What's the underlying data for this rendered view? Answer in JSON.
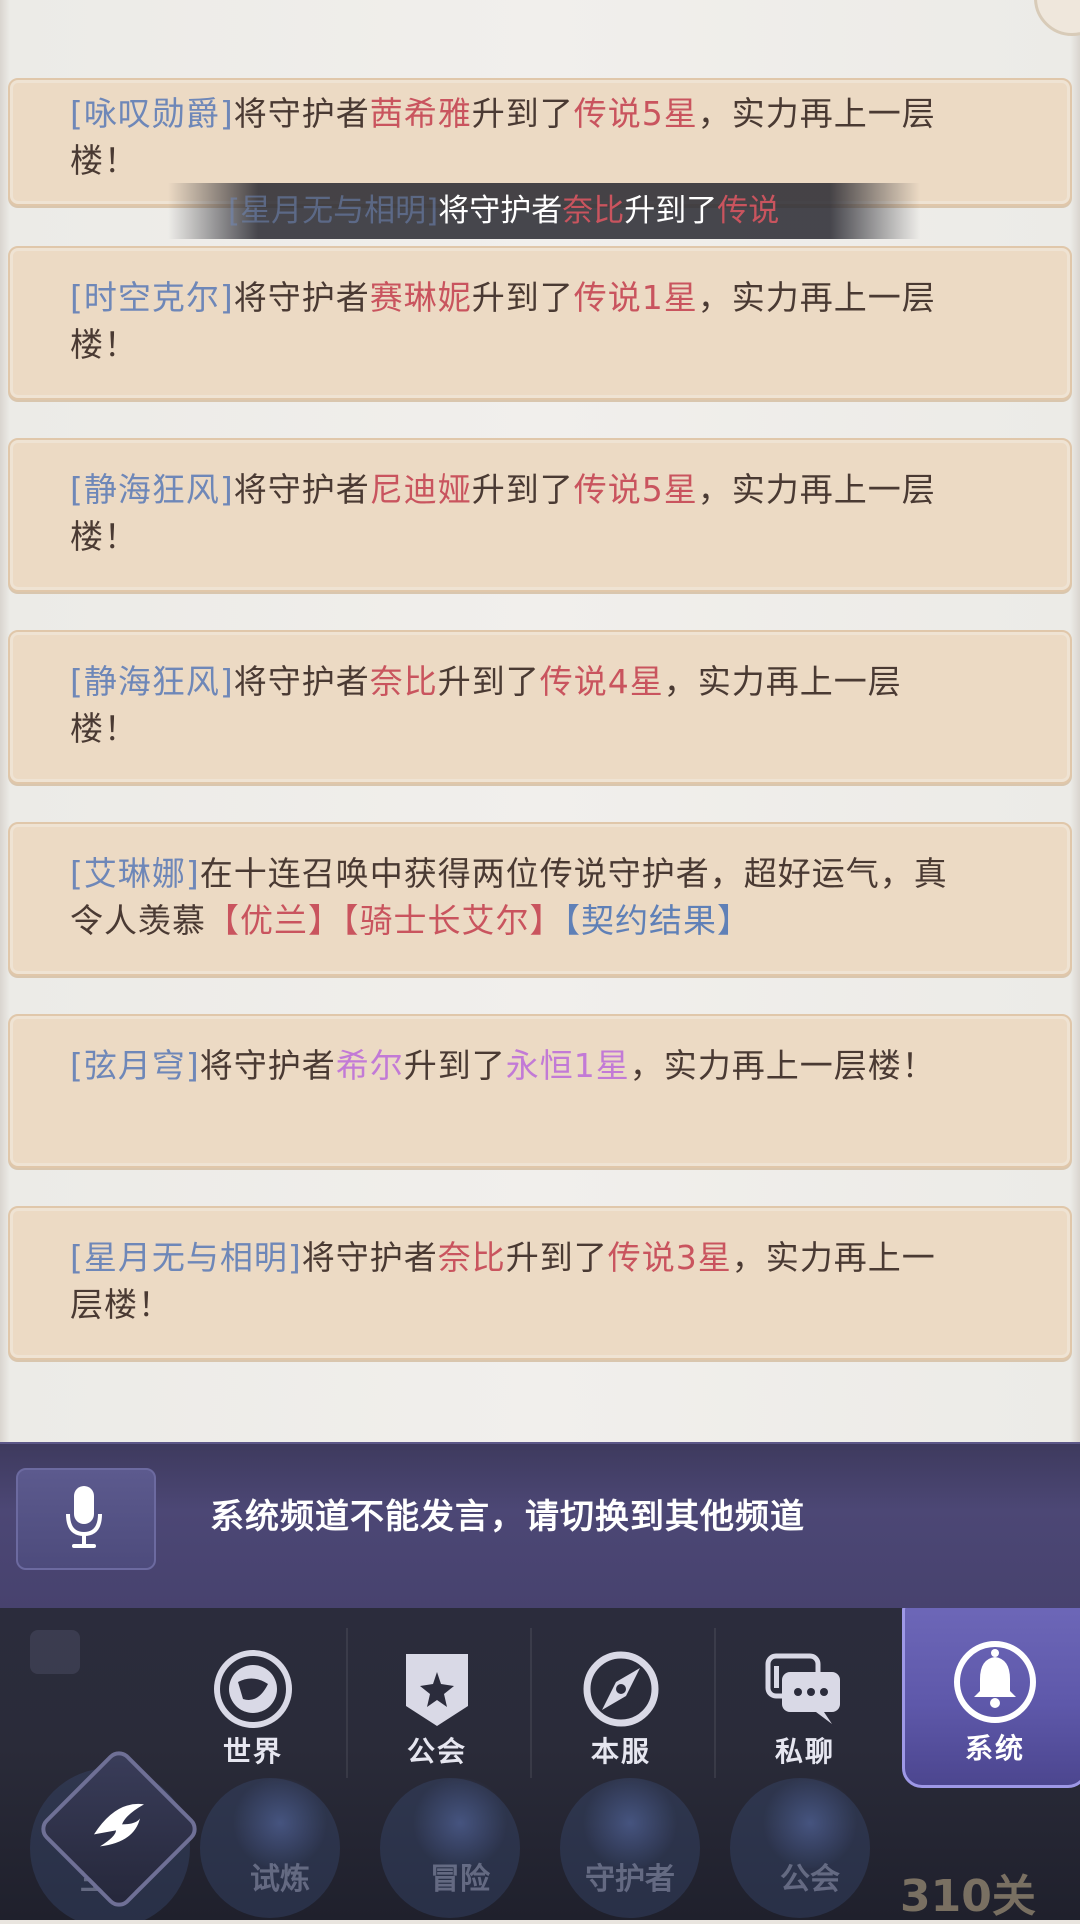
{
  "messages": [
    {
      "name": "[咏叹勋爵]",
      "pre": "将守护者",
      "hero": "茜希雅",
      "mid": "升到了",
      "rank": "传说5星",
      "post": "，实力再上一层楼！"
    },
    {
      "name": "[时空克尔]",
      "pre": "将守护者",
      "hero": "赛琳妮",
      "mid": "升到了",
      "rank": "传说1星",
      "post": "，实力再上一层楼！"
    },
    {
      "name": "[静海狂风]",
      "pre": "将守护者",
      "hero": "尼迪娅",
      "mid": "升到了",
      "rank": "传说5星",
      "post": "，实力再上一层楼！"
    },
    {
      "name": "[静海狂风]",
      "pre": "将守护者",
      "hero": "奈比",
      "mid": "升到了",
      "rank": "传说4星",
      "post": "，实力再上一层楼！"
    },
    {
      "name": "[艾琳娜]",
      "text": "在十连召唤中获得两位传说守护者，超好运气，真令人羡慕",
      "tag1": "【优兰】",
      "tag2": "【骑士长艾尔】",
      "tag3": "【契约结果】"
    },
    {
      "name": "[弦月穹]",
      "pre": "将守护者",
      "hero": "希尔",
      "mid": "升到了",
      "rank": "永恒1星",
      "post": "，实力再上一层楼！"
    },
    {
      "name": "[星月无与相明]",
      "pre": "将守护者",
      "hero": "奈比",
      "mid": "升到了",
      "rank": "传说3星",
      "post": "，实力再上一层楼！"
    }
  ],
  "ticker": {
    "name": "[星月无与相明]",
    "pre": "将守护者",
    "hero": "奈比",
    "mid": "升到了",
    "rank": "传说"
  },
  "input": {
    "notice": "系统频道不能发言，请切换到其他频道",
    "mic_icon": "microphone-icon"
  },
  "tabs": [
    {
      "label": "世界",
      "icon": "globe-icon"
    },
    {
      "label": "公会",
      "icon": "guild-banner-icon"
    },
    {
      "label": "本服",
      "icon": "compass-icon"
    },
    {
      "label": "私聊",
      "icon": "chat-bubble-icon"
    },
    {
      "label": "系统",
      "icon": "bell-icon",
      "active": true
    }
  ],
  "bottom_nav": [
    {
      "label": "主城"
    },
    {
      "label": "试炼"
    },
    {
      "label": "冒险"
    },
    {
      "label": "守护者"
    },
    {
      "label": "公会"
    }
  ],
  "stage_count": "310关",
  "colors": {
    "name": "#6e87b8",
    "hero": "#c9545e",
    "eternal": "#c27ad6",
    "active_tab": "#5e58aa"
  }
}
